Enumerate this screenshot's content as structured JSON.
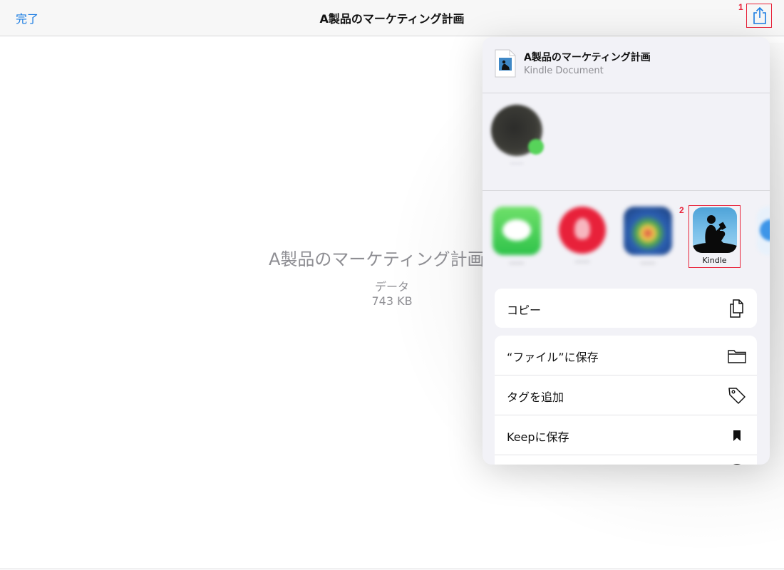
{
  "navbar": {
    "done_label": "完了",
    "title": "A製品のマーケティング計画",
    "share_icon": "share-icon"
  },
  "annotations": {
    "share_marker": "1",
    "kindle_marker": "2"
  },
  "preview": {
    "title": "A製品のマーケティング計画",
    "kind": "データ",
    "size": "743 KB"
  },
  "share_sheet": {
    "doc": {
      "name": "A製品のマーケティング計画",
      "subtitle": "Kindle Document",
      "icon": "kindle-document-icon"
    },
    "apps": [
      {
        "name": "messages-app",
        "icon": "messages-icon"
      },
      {
        "name": "pinterest-app",
        "icon": "pinterest-icon"
      },
      {
        "name": "browser-app",
        "icon": "browser-icon"
      },
      {
        "name": "kindle-app",
        "label": "Kindle",
        "icon": "kindle-icon"
      }
    ],
    "actions_group1": [
      {
        "label": "コピー",
        "icon": "copy-icon"
      }
    ],
    "actions_group2": [
      {
        "label": "“ファイル”に保存",
        "icon": "folder-icon"
      },
      {
        "label": "タグを追加",
        "icon": "tag-icon"
      },
      {
        "label": "Keepに保存",
        "icon": "bookmark-icon"
      }
    ]
  },
  "colors": {
    "accent": "#1a7ce2",
    "annotation_red": "#e8233a",
    "kindle_blue": "#4ea3d8"
  }
}
